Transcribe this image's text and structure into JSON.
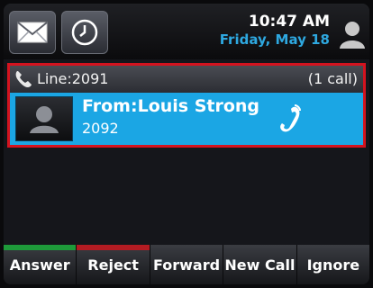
{
  "status": {
    "time": "10:47 AM",
    "date": "Friday, May 18"
  },
  "line": {
    "label": "Line:2091",
    "call_count": "(1 call)"
  },
  "call": {
    "from": "From:Louis Strong",
    "number": "2092"
  },
  "softkeys": [
    {
      "label": "Answer",
      "indicator_color": "#1e9a3a"
    },
    {
      "label": "Reject",
      "indicator_color": "#b31b22"
    },
    {
      "label": "Forward"
    },
    {
      "label": "New Call"
    },
    {
      "label": "Ignore"
    }
  ],
  "icons": {
    "top_left": "mail-icon",
    "top_second": "clock-icon",
    "top_right": "user-icon",
    "line": "phone-handset-icon",
    "call": "ringing-phone-icon"
  },
  "colors": {
    "accent_blue": "#1ba6e4",
    "highlight_red": "#d4131f",
    "date_blue": "#2ea8e0"
  }
}
